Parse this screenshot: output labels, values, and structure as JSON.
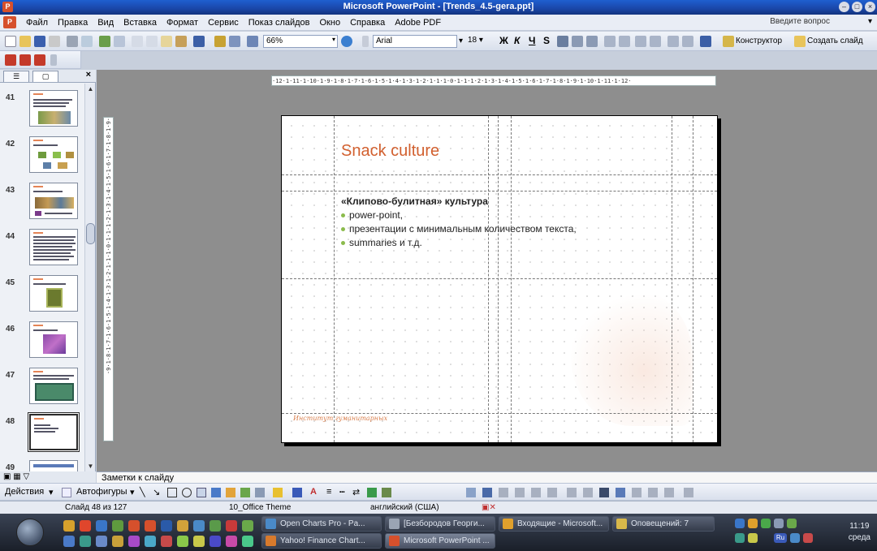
{
  "window": {
    "title": "Microsoft PowerPoint - [Trends_4.5-gera.ppt]"
  },
  "menu": {
    "items": [
      "Файл",
      "Правка",
      "Вид",
      "Вставка",
      "Формат",
      "Сервис",
      "Показ слайдов",
      "Окно",
      "Справка",
      "Adobe PDF"
    ],
    "question_placeholder": "Введите вопрос"
  },
  "toolbar": {
    "zoom": "66%",
    "font": "Arial",
    "font_size": "18",
    "bold": "Ж",
    "italic": "К",
    "underline": "Ч",
    "shadow": "S",
    "designer": "Конструктор",
    "new_slide": "Создать слайд"
  },
  "slides_pane": {
    "thumbnails": [
      {
        "number": "41"
      },
      {
        "number": "42"
      },
      {
        "number": "43"
      },
      {
        "number": "44"
      },
      {
        "number": "45"
      },
      {
        "number": "46"
      },
      {
        "number": "47"
      },
      {
        "number": "48",
        "selected": true
      },
      {
        "number": "49"
      }
    ]
  },
  "rulers": {
    "horizontal": "·12·1·11·1·10·1·9·1·8·1·7·1·6·1·5·1·4·1·3·1·2·1·1·1·0·1·1·1·2·1·3·1·4·1·5·1·6·1·7·1·8·1·9·1·10·1·11·1·12·",
    "vertical": "·9·1·8·1·7·1·6·1·5·1·4·1·3·1·2·1·1·1·0·1·1·1·2·1·3·1·4·1·5·1·6·1·7·1·8·1·9·"
  },
  "slide": {
    "title": "Snack culture",
    "heading": "«Клипово-булитная» культура",
    "bullets": [
      "power-point,",
      "презентации с минимальным количеством текста,",
      "summaries и т.д."
    ],
    "logo_text": "Институт гуманитарных"
  },
  "notes": {
    "label": "Заметки к слайду"
  },
  "draw_toolbar": {
    "actions": "Действия",
    "autoshapes": "Автофигуры"
  },
  "status": {
    "slide_counter": "Слайд 48 из 127",
    "theme": "10_Office Theme",
    "language": "английский (США)"
  },
  "taskbar": {
    "tasks_row1": [
      "Open Charts Pro - Pa...",
      "[Безбородов Георги...",
      "Входящие - Microsoft...",
      "Оповещений: 7"
    ],
    "tasks_row2": [
      "Yahoo! Finance Chart...",
      "Microsoft PowerPoint ..."
    ],
    "clock_time": "11:19",
    "clock_day": "среда",
    "language_indicator": "Ru"
  },
  "colors": {
    "title_orange": "#d2602f",
    "bullet_green": "#8bbb4c",
    "xp_blue": "#1a46a8"
  }
}
